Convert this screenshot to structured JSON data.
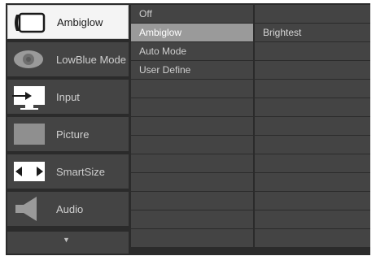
{
  "menu": {
    "items": [
      {
        "label": "Ambiglow",
        "icon": "ambiglow-icon",
        "active": true
      },
      {
        "label": "LowBlue Mode",
        "icon": "lowblue-eye-icon",
        "active": false
      },
      {
        "label": "Input",
        "icon": "input-icon",
        "active": false
      },
      {
        "label": "Picture",
        "icon": "picture-icon",
        "active": false
      },
      {
        "label": "SmartSize",
        "icon": "smartsize-icon",
        "active": false
      },
      {
        "label": "Audio",
        "icon": "speaker-icon",
        "active": false
      }
    ],
    "more_icon": "chevron-down-icon",
    "more_glyph": "▼"
  },
  "submenu": {
    "options": [
      "Off",
      "Ambiglow",
      "Auto Mode",
      "User Define"
    ],
    "selected": "Ambiglow"
  },
  "values": {
    "options": [
      "Brightest"
    ]
  },
  "colors": {
    "panel": "#2b2b2b",
    "item": "#444444",
    "selected": "#9a9a9a",
    "active_item": "#f4f4f4"
  }
}
